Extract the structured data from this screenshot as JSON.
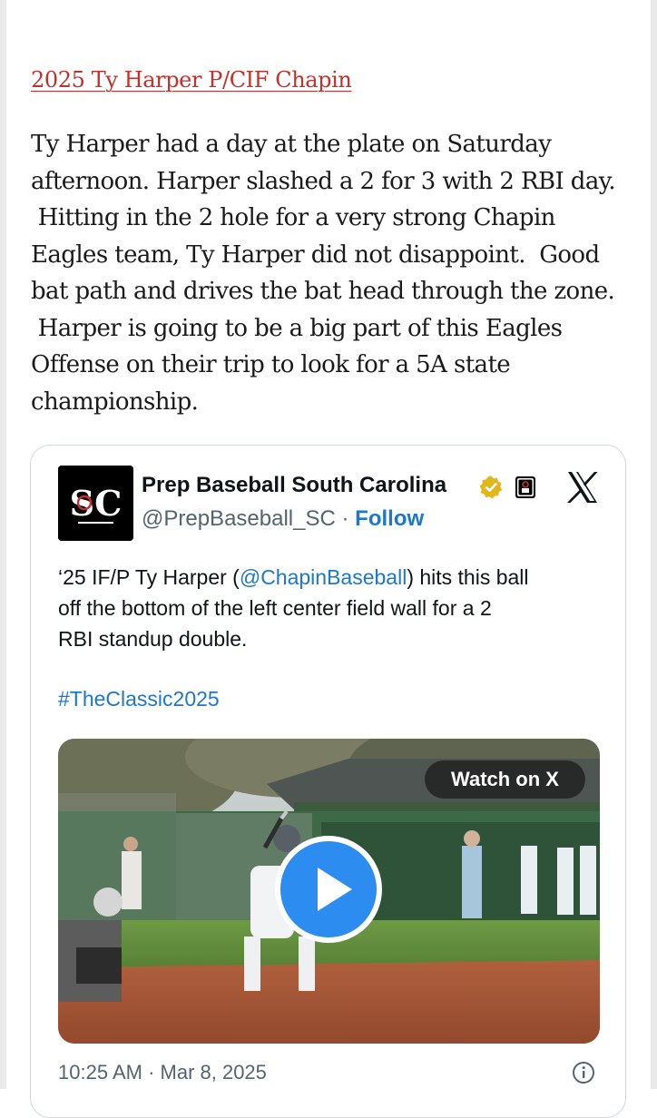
{
  "article": {
    "link_text": "2025 Ty Harper P/CIF Chapin",
    "body_lines": [
      "Ty Harper had a day at the plate on Saturday",
      "afternoon. Harper slashed a 2 for 3 with 2 RBI day.",
      " Hitting in the 2 hole for a very strong Chapin",
      "Eagles team, Ty Harper did not disappoint.  Good",
      "bat path and drives the bat head through the zone.",
      " Harper is going to be a big part of this Eagles",
      "Offense on their trip to look for a 5A state",
      "championship."
    ]
  },
  "tweet": {
    "avatar_text": "SC",
    "display_name": "Prep Baseball South Carolina",
    "handle": "@PrepBaseball_SC",
    "separator": "·",
    "follow_label": "Follow",
    "text_line1_prefix": "‘25 IF/P Ty Harper (",
    "mention": "@ChapinBaseball",
    "text_line1_suffix": ") hits this ball",
    "text_line2": "off the bottom of the left center field wall for a 2",
    "text_line3": "RBI standup double.",
    "hashtag": "#TheClassic2025",
    "watch_label": "Watch on X",
    "timestamp": "10:25 AM · Mar 8, 2025"
  },
  "icons": {
    "verified": "verified-gold-badge-icon",
    "affiliate": "affiliate-badge-icon",
    "brand": "x-logo-icon",
    "play": "play-icon",
    "info": "info-icon"
  },
  "colors": {
    "link_red": "#c4302b",
    "x_blue": "#1d77cc",
    "muted_gray": "#536471",
    "verified_gold": "#e2b719",
    "play_blue": "#2d8cf0"
  }
}
